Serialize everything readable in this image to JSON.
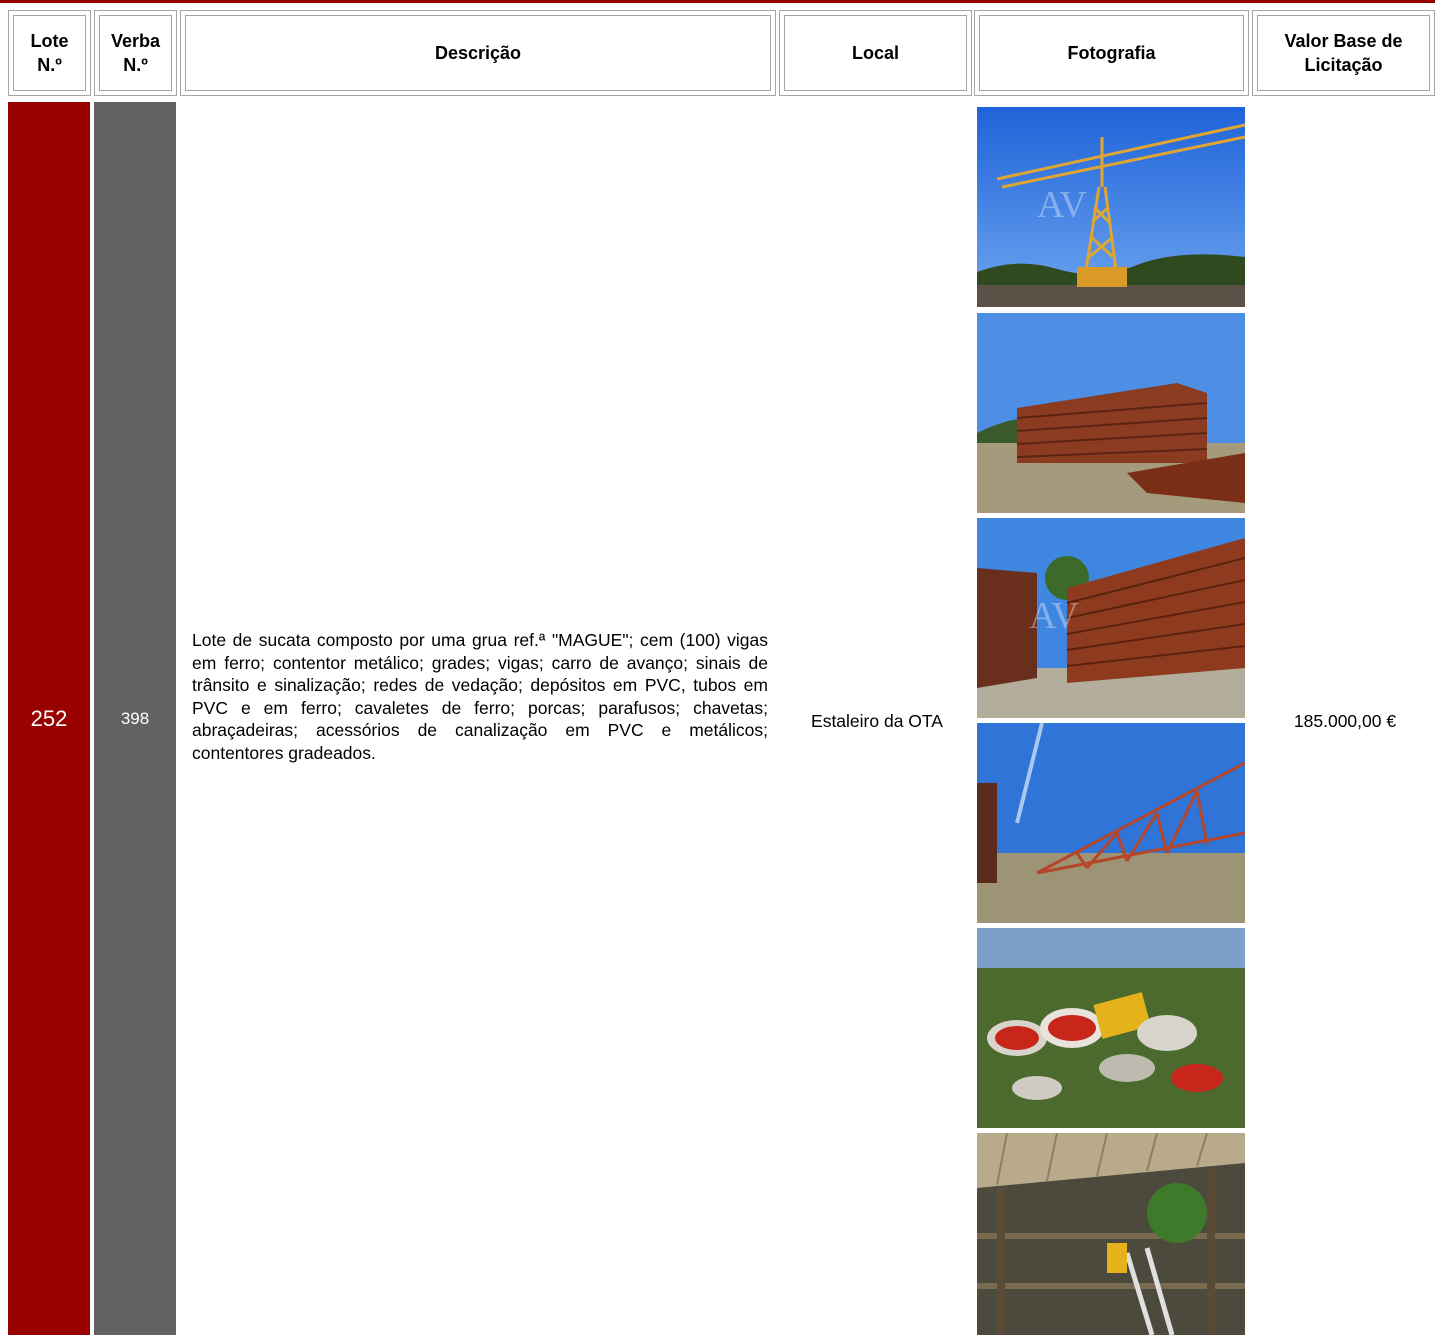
{
  "table": {
    "headers": {
      "lote": "Lote\nN.º",
      "verba": "Verba\nN.º",
      "descricao": "Descrição",
      "local": "Local",
      "fotografia": "Fotografia",
      "valor": "Valor Base de\nLicitação"
    },
    "row": {
      "lote": "252",
      "verba": "398",
      "descricao": "Lote de sucata composto por uma grua ref.ª \"MAGUE\"; cem (100) vigas em ferro; contentor metálico; grades; vigas; carro de avanço; sinais de trânsito e sinalização; redes de vedação; depósitos em PVC, tubos em PVC e em ferro; cavaletes de ferro; porcas; parafusos; chavetas; abraçadeiras; acessórios de canalização em PVC e metálicos;    contentores gradeados.",
      "local": "Estaleiro da OTA",
      "valor": "185.000,00 €",
      "photos": [
        {
          "icon": "crane-photo"
        },
        {
          "icon": "steel-beams-photo"
        },
        {
          "icon": "stacked-beams-photo"
        },
        {
          "icon": "crane-jib-photo"
        },
        {
          "icon": "traffic-signs-photo"
        },
        {
          "icon": "storage-shed-photo"
        }
      ]
    }
  },
  "colors": {
    "accent": "#9b0000",
    "lote_bg": "#990000",
    "verba_bg": "#626262",
    "header_border": "#a6a6a6"
  }
}
